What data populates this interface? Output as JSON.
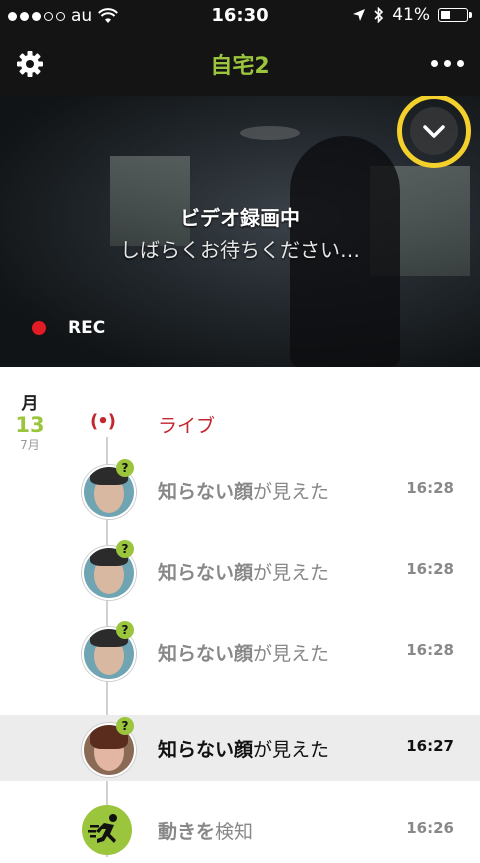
{
  "status_bar": {
    "carrier": "au",
    "time": "16:30",
    "battery": "41%",
    "battery_level": 0.41
  },
  "nav": {
    "title": "自宅2",
    "left_icon": "gear-icon",
    "right_icon": "more-icon"
  },
  "video": {
    "title": "ビデオ録画中",
    "subtitle": "しばらくお待ちください…",
    "rec_label": "REC",
    "rec_color": "#e21b24",
    "toggle_icon": "chevron-down-icon",
    "highlight_color": "#f3d02b"
  },
  "timeline": {
    "date": {
      "weekday": "月",
      "day": "13",
      "month": "7月"
    },
    "live_label": "ライブ",
    "live_icon": "(•)",
    "accent_color": "#9bc53d",
    "live_color": "#c1272d",
    "events": [
      {
        "strong": "知らない顔",
        "rest": "が見えた",
        "time": "16:28",
        "badge": "?",
        "avatar": "unknown-face-man"
      },
      {
        "strong": "知らない顔",
        "rest": "が見えた",
        "time": "16:28",
        "badge": "?",
        "avatar": "unknown-face-man"
      },
      {
        "strong": "知らない顔",
        "rest": "が見えた",
        "time": "16:28",
        "badge": "?",
        "avatar": "unknown-face-man"
      },
      {
        "strong": "知らない顔",
        "rest": "が見えた",
        "time": "16:27",
        "badge": "?",
        "avatar": "unknown-face-woman",
        "selected": true
      },
      {
        "strong": "動きを",
        "rest": "検知",
        "time": "16:26",
        "avatar": "motion-icon"
      }
    ]
  }
}
